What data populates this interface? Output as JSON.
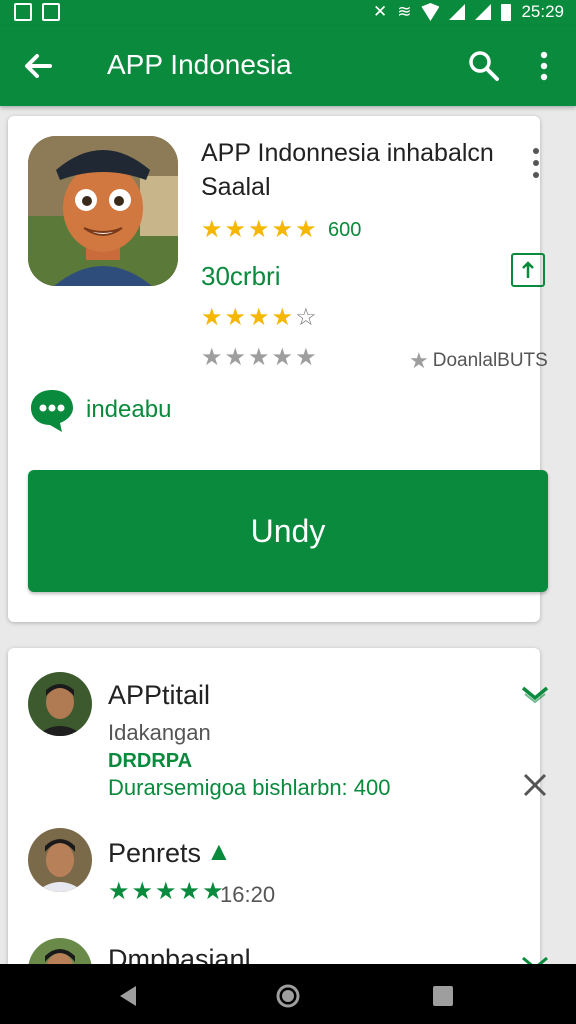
{
  "status_bar": {
    "time": "25:29"
  },
  "app_bar": {
    "title": "APP Indonesia"
  },
  "app_card": {
    "name": "APP Indonnesia inhabalcn Saalal",
    "rating_count": "600",
    "sub_label": "30crbri",
    "stat_label": "DoanlalBUTS",
    "chat_label": "indeabu",
    "install_label": "Undy",
    "star_rating_1": 5,
    "star_rating_2": 4,
    "star_rating_grey": 5
  },
  "reviews": [
    {
      "name": "APPtitail",
      "line1": "Idakangan",
      "line2": "DRDRPA",
      "line3": "Durarsemigoa bishlarbn: 400"
    },
    {
      "name": "Penrets",
      "rating": 5,
      "time": "16:20"
    },
    {
      "name": "Dmpbasianl"
    }
  ],
  "colors": {
    "primary": "#0a8a3c",
    "star_gold": "#f5b700",
    "star_grey": "#9e9e9e"
  }
}
